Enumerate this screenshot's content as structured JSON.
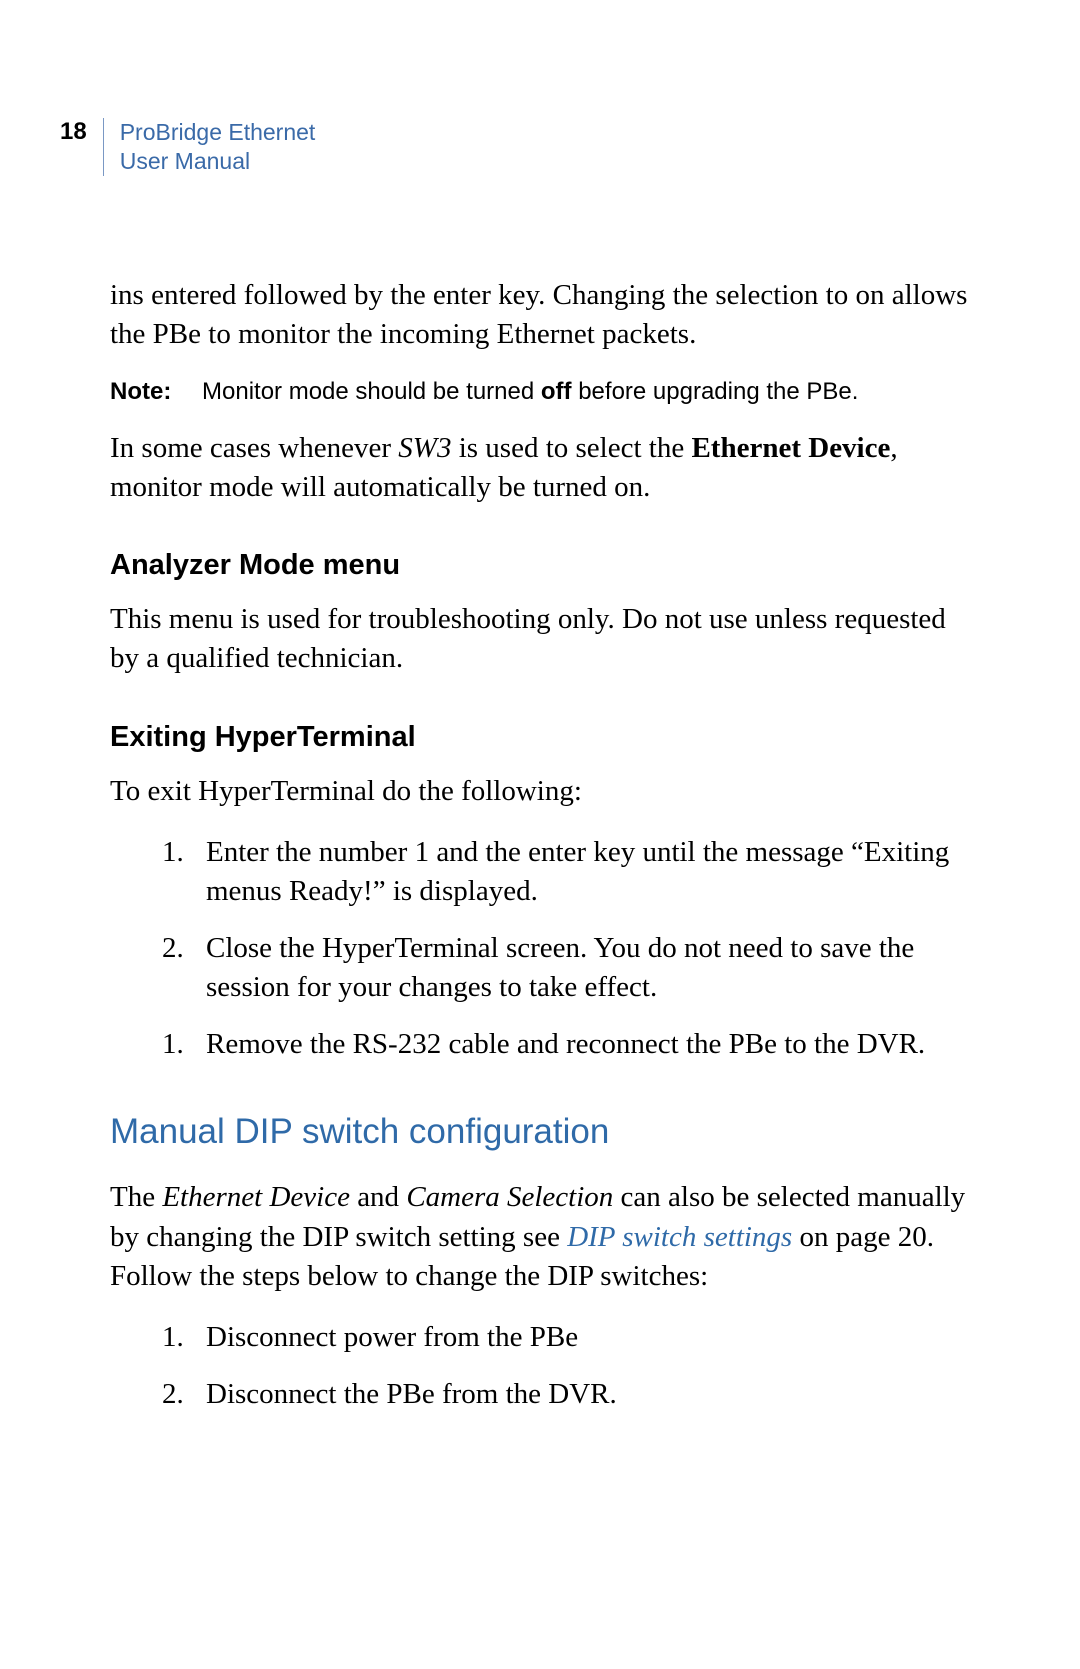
{
  "header": {
    "page_number": "18",
    "title_line1": "ProBridge Ethernet",
    "title_line2": "User Manual"
  },
  "para1_a": "ins entered followed by the enter key. Changing the selection to on allows the PBe to monitor the incoming Ethernet packets.",
  "note": {
    "label": "Note:",
    "before": "Monitor mode should be turned ",
    "bold": "off",
    "after": " before upgrading the PBe."
  },
  "para2": {
    "a": "In some cases whenever ",
    "sw3": "SW3",
    "b": " is used to select the ",
    "eth": "Ethernet Device",
    "c": ", monitor mode will automatically be turned on."
  },
  "h3_analyzer": "Analyzer Mode menu",
  "para3": "This menu is used for troubleshooting only. Do not use unless requested by a qualified technician.",
  "h3_exiting": "Exiting  HyperTerminal",
  "para4": "To exit HyperTerminal do the following:",
  "steps1": [
    {
      "n": "1.",
      "t": "Enter the number 1 and the enter key until the message “Exiting menus Ready!” is displayed."
    },
    {
      "n": "2.",
      "t": "Close the HyperTerminal screen. You do not need to save the session for your changes to take effect."
    },
    {
      "n": "1.",
      "t": "Remove the RS-232 cable and reconnect the PBe to the DVR."
    }
  ],
  "h2_dip": "Manual DIP switch configuration",
  "para5": {
    "a": "The ",
    "i1": "Ethernet Device",
    "b": " and ",
    "i2": "Camera Selection",
    "c": " can also be selected manually by changing the DIP switch setting see ",
    "link": "DIP switch settings",
    "d": " on page 20. Follow the steps below to change the DIP switches:"
  },
  "steps2": [
    {
      "n": "1.",
      "t": "Disconnect power from the PBe"
    },
    {
      "n": "2.",
      "t": "Disconnect the PBe from the DVR."
    }
  ]
}
